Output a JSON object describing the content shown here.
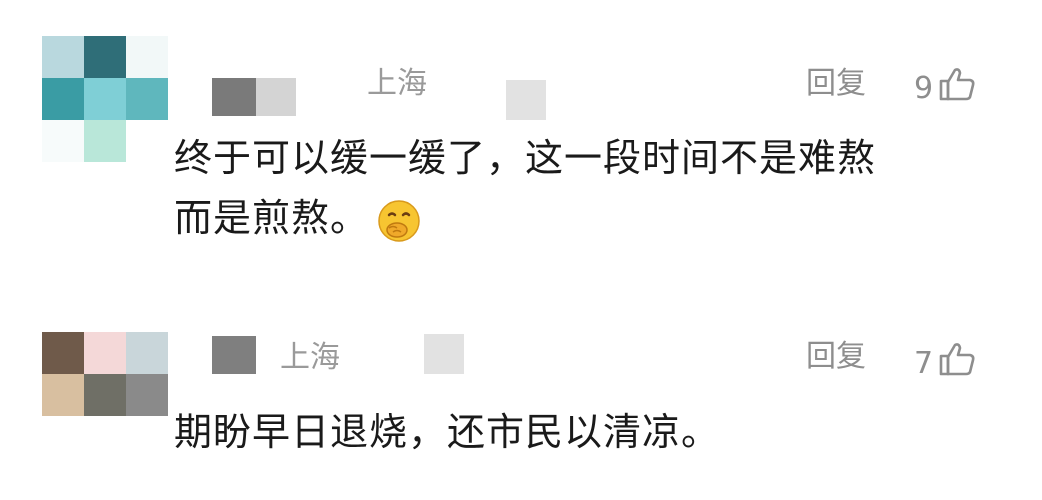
{
  "comments": [
    {
      "location": "上海",
      "reply_label": "回复",
      "likes": "9",
      "text_line1": "终于可以缓一缓了，这一段时间不是难熬",
      "text_line2": "而是煎熬。",
      "emoji": "hand-over-mouth-emoji",
      "avatar_colors": [
        "#b9d8de",
        "#2f6e78",
        "#f2f8f8",
        "#3a9ca4",
        "#7fcfd6",
        "#5fb7bd",
        "#f7fbfb",
        "#b9e7d9",
        "#ffffff"
      ],
      "name_blur_colors": [
        "#7a7a7a",
        "#cfcfcf"
      ]
    },
    {
      "location": "上海",
      "reply_label": "回复",
      "likes": "7",
      "text_line1": "期盼早日退烧，还市民以清凉。",
      "avatar_colors": [
        "#6f5a4a",
        "#f4d8d8",
        "#c9d6da",
        "#d8bfa0",
        "#6f6f66",
        "#8a8a8a"
      ],
      "name_blur_colors": [
        "#7f7f7f"
      ]
    }
  ]
}
